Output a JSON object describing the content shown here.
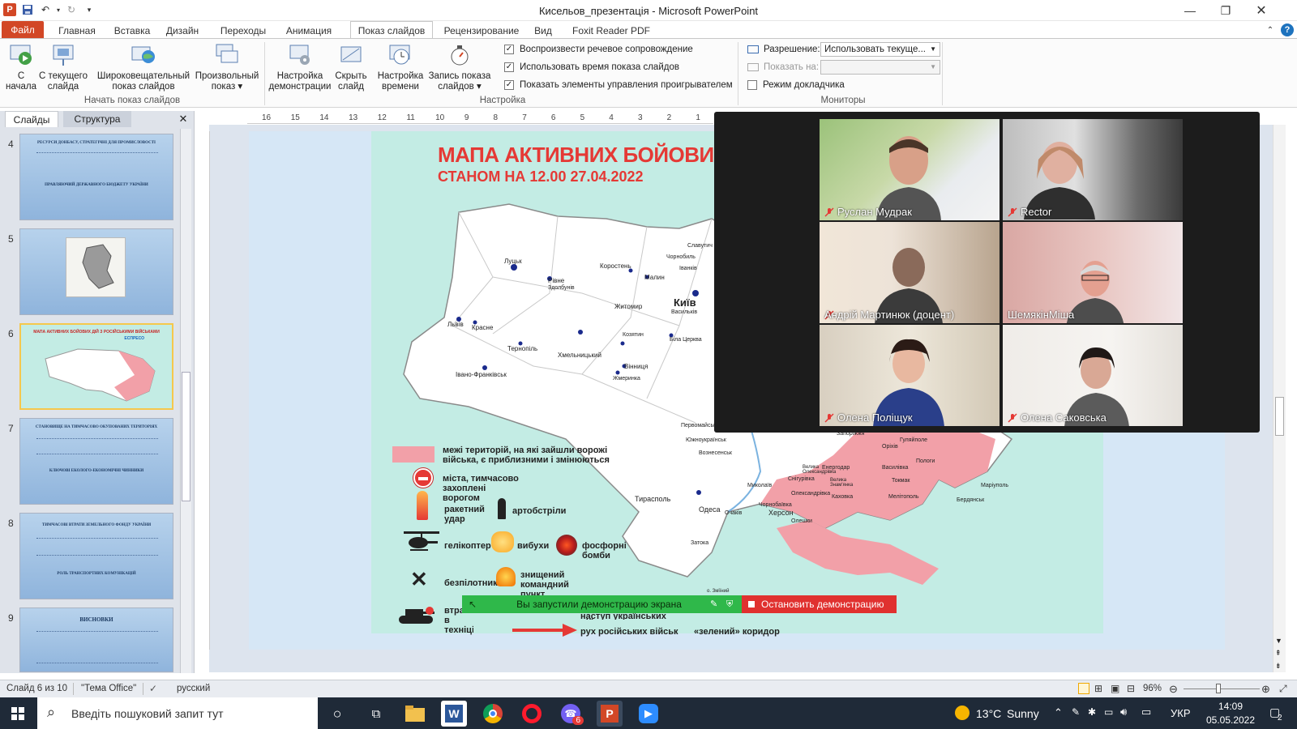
{
  "window": {
    "title": "Кисельов_презентація - Microsoft PowerPoint"
  },
  "tabs": [
    {
      "label": "Файл"
    },
    {
      "label": "Главная"
    },
    {
      "label": "Вставка"
    },
    {
      "label": "Дизайн"
    },
    {
      "label": "Переходы"
    },
    {
      "label": "Анимация"
    },
    {
      "label": "Показ слайдов"
    },
    {
      "label": "Рецензирование"
    },
    {
      "label": "Вид"
    },
    {
      "label": "Foxit Reader PDF"
    }
  ],
  "ribbon": {
    "from_start": {
      "line1": "С",
      "line2": "начала"
    },
    "from_current": {
      "line1": "С текущего",
      "line2": "слайда"
    },
    "broadcast": {
      "line1": "Широковещательный",
      "line2": "показ слайдов"
    },
    "custom": {
      "line1": "Произвольный",
      "line2": "показ"
    },
    "group_start": "Начать показ слайдов",
    "setup_show": {
      "line1": "Настройка",
      "line2": "демонстрации"
    },
    "hide_slide": {
      "line1": "Скрыть",
      "line2": "слайд"
    },
    "rehearse": {
      "line1": "Настройка",
      "line2": "времени"
    },
    "record": {
      "line1": "Запись показа",
      "line2": "слайдов"
    },
    "chk_narration": "Воспроизвести речевое сопровождение",
    "chk_timings": "Использовать время показа слайдов",
    "chk_controls": "Показать элементы управления проигрывателем",
    "group_setup": "Настройка",
    "resolution_label": "Разрешение:",
    "resolution_value": "Использовать текуще...",
    "show_on_label": "Показать на:",
    "presenter_view": "Режим докладчика",
    "group_monitors": "Мониторы"
  },
  "panel": {
    "tab_slides": "Слайды",
    "tab_outline": "Структура",
    "thumbs": [
      {
        "num": "4",
        "l1": "РЕСУРСИ ДОНБАСУ, СТРАТЕГІЧНІ ДЛЯ ПРОМИСЛОВОСТІ",
        "l2": "ПРАВЛЯЮЧИЙ ДЕРЖАВНОГО БЮДЖЕТУ УКРАЇНИ"
      },
      {
        "num": "5",
        "l1": "",
        "l2": ""
      },
      {
        "num": "6",
        "l1": "МАПА АКТИВНИХ БОЙОВИХ ДІЙ З РОСІЙСЬКИМИ ВІЙСЬКАМИ",
        "l2": "ЕСПРЕСО"
      },
      {
        "num": "7",
        "l1": "СТАНОВИЩЕ НА ТИМЧАСОВО ОКУПОВАНИХ ТЕРИТОРІЯХ",
        "l2": "КЛЮЧОВІ ЕКОЛОГО-ЕКОНОМІЧНІ ЧИННИКИ"
      },
      {
        "num": "8",
        "l1": "ТИМЧАСОВІ ВТРАТИ ЗЕМЕЛЬНОГО ФОНДУ УКРАЇНИ",
        "l2": "РОЛЬ ТРАНСПОРТНИХ КОМУНІКАЦІЙ"
      },
      {
        "num": "9",
        "l1": "ВИСНОВКИ",
        "l2": ""
      }
    ]
  },
  "slide": {
    "title": "МАПА АКТИВНИХ БОЙОВИХ",
    "subtitle": "СТАНОМ НА 12.00 27.04.2022",
    "cities": [
      {
        "name": "Луцьк"
      },
      {
        "name": "Рівне"
      },
      {
        "name": "Здолбунів"
      },
      {
        "name": "Коростень"
      },
      {
        "name": "Малин"
      },
      {
        "name": "Чорнобиль"
      },
      {
        "name": "Славутич"
      },
      {
        "name": "Іванків"
      },
      {
        "name": "Київ"
      },
      {
        "name": "Васильків"
      },
      {
        "name": "Житомир"
      },
      {
        "name": "Львів"
      },
      {
        "name": "Красне"
      },
      {
        "name": "Тернопіль"
      },
      {
        "name": "Хмельницький"
      },
      {
        "name": "Козятин"
      },
      {
        "name": "Біла Церква"
      },
      {
        "name": "Вінниця"
      },
      {
        "name": "Івано-Франківськ"
      },
      {
        "name": "Жмеринка"
      },
      {
        "name": "Первомайськ"
      },
      {
        "name": "Южноукраїнськ"
      },
      {
        "name": "Вознесенськ"
      },
      {
        "name": "Запоріжжя"
      },
      {
        "name": "Енергодар"
      },
      {
        "name": "Оріхів"
      },
      {
        "name": "Гуляйполе"
      },
      {
        "name": "Пологи"
      },
      {
        "name": "Василівка"
      },
      {
        "name": "Токмак"
      },
      {
        "name": "Мелітополь"
      },
      {
        "name": "Бердянськ"
      },
      {
        "name": "Маріуполь"
      },
      {
        "name": "Миколаїв"
      },
      {
        "name": "Херсон"
      },
      {
        "name": "Каховка"
      },
      {
        "name": "Тирасполь"
      },
      {
        "name": "Одеса"
      },
      {
        "name": "Очаків"
      },
      {
        "name": "Затока"
      },
      {
        "name": "Снігурівка"
      },
      {
        "name": "Олександрівка"
      },
      {
        "name": "Олешки"
      },
      {
        "name": "Чорнобаївка"
      },
      {
        "name": "Велика Олександрівка"
      },
      {
        "name": "Велика Знам'янка"
      },
      {
        "name": "о. Зміїний"
      }
    ],
    "legend": {
      "boundary": "межі територій, на які зайшли ворожі війська, є приблизними і змінюються",
      "captured": "міста, тимчасово захоплені ворогом",
      "rocket": "ракетний удар",
      "artillery": "артобстріли",
      "helicopter": "гелікоптер",
      "explosions": "вибухи",
      "phosphor": "фосфорні бомби",
      "drone": "безпілотник",
      "command": "знищений командний пункт",
      "losses": "втрати в техніці",
      "counter": "наступ українських військ",
      "russian_move": "рух російських військ",
      "green_corridor": "«зелений» коридор"
    }
  },
  "ruler": {
    "ticks": [
      "16",
      "15",
      "14",
      "13",
      "12",
      "11",
      "10",
      "9",
      "8",
      "7",
      "6",
      "5",
      "4",
      "3",
      "2",
      "1"
    ]
  },
  "zoom": {
    "participants": [
      {
        "name": "Руслан Мудрак"
      },
      {
        "name": "Rector"
      },
      {
        "name": "Андрій Мартинюк (доцент)"
      },
      {
        "name": "ШемякінМіша"
      },
      {
        "name": "Олена Поліщук"
      },
      {
        "name": "Олена Саковська"
      }
    ]
  },
  "share": {
    "status": "Вы запустили демонстрацию экрана",
    "stop": "Остановить демонстрацию"
  },
  "status": {
    "slide": "Слайд 6 из 10",
    "theme": "\"Тема Office\"",
    "language": "русский",
    "zoom": "96%"
  },
  "taskbar": {
    "search_placeholder": "Введіть пошуковий запит тут",
    "weather_temp": "13°C",
    "weather_text": "Sunny",
    "lang": "УКР",
    "time": "14:09",
    "date": "05.05.2022",
    "viber_badge": "6",
    "notif_badge": "2"
  },
  "colors": {
    "accent": "#d24726",
    "map_bg": "#c3ece4",
    "occupied": "#f2a0a8",
    "share_green": "#2fb84a",
    "stop_red": "#e0312f"
  }
}
